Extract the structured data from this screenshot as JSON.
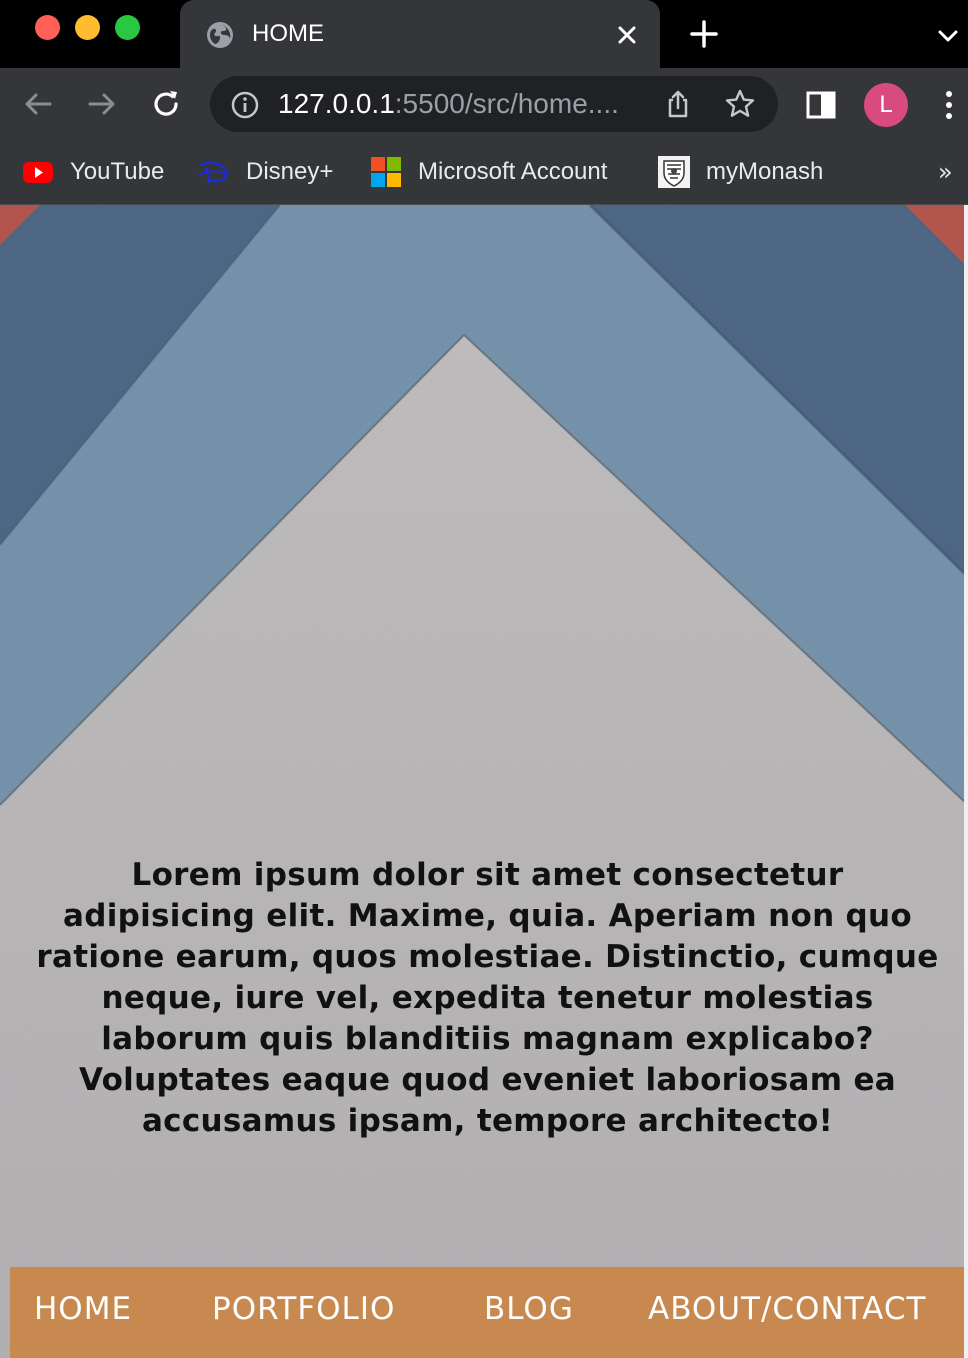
{
  "window": {
    "tab": {
      "title": "HOME",
      "favicon": "globe-icon"
    }
  },
  "toolbar": {
    "url": {
      "host": "127.0.0.1",
      "rest": ":5500/src/home...."
    },
    "avatar_letter": "L"
  },
  "bookmarks": [
    {
      "label": "YouTube",
      "icon": "youtube-icon"
    },
    {
      "label": "Disney+",
      "icon": "disney-icon"
    },
    {
      "label": "Microsoft Account",
      "icon": "microsoft-icon"
    },
    {
      "label": "myMonash",
      "icon": "monash-icon"
    }
  ],
  "bookmarks_more": "»",
  "page": {
    "hero_text": "Lorem ipsum dolor sit amet consectetur adipisicing elit. Maxime, quia. Aperiam non quo ratione earum, quos molestiae. Distinctio, cumque neque, iure vel, expedita tenetur molestias laborum quis blanditiis magnam explicabo? Voluptates eaque quod eveniet laboriosam ea accusamus ipsam, tempore architecto!",
    "nav": [
      "HOME",
      "PORTFOLIO",
      "BLOG",
      "ABOUT/CONTACT"
    ]
  },
  "colors": {
    "nav_bg": "#c7894f",
    "avatar_bg": "#d94a7e",
    "paper_white": "#d6d2d4",
    "paper_light_blue": "#6b98bd",
    "paper_dark_blue": "#2f5582",
    "paper_red": "#c93a2c"
  }
}
